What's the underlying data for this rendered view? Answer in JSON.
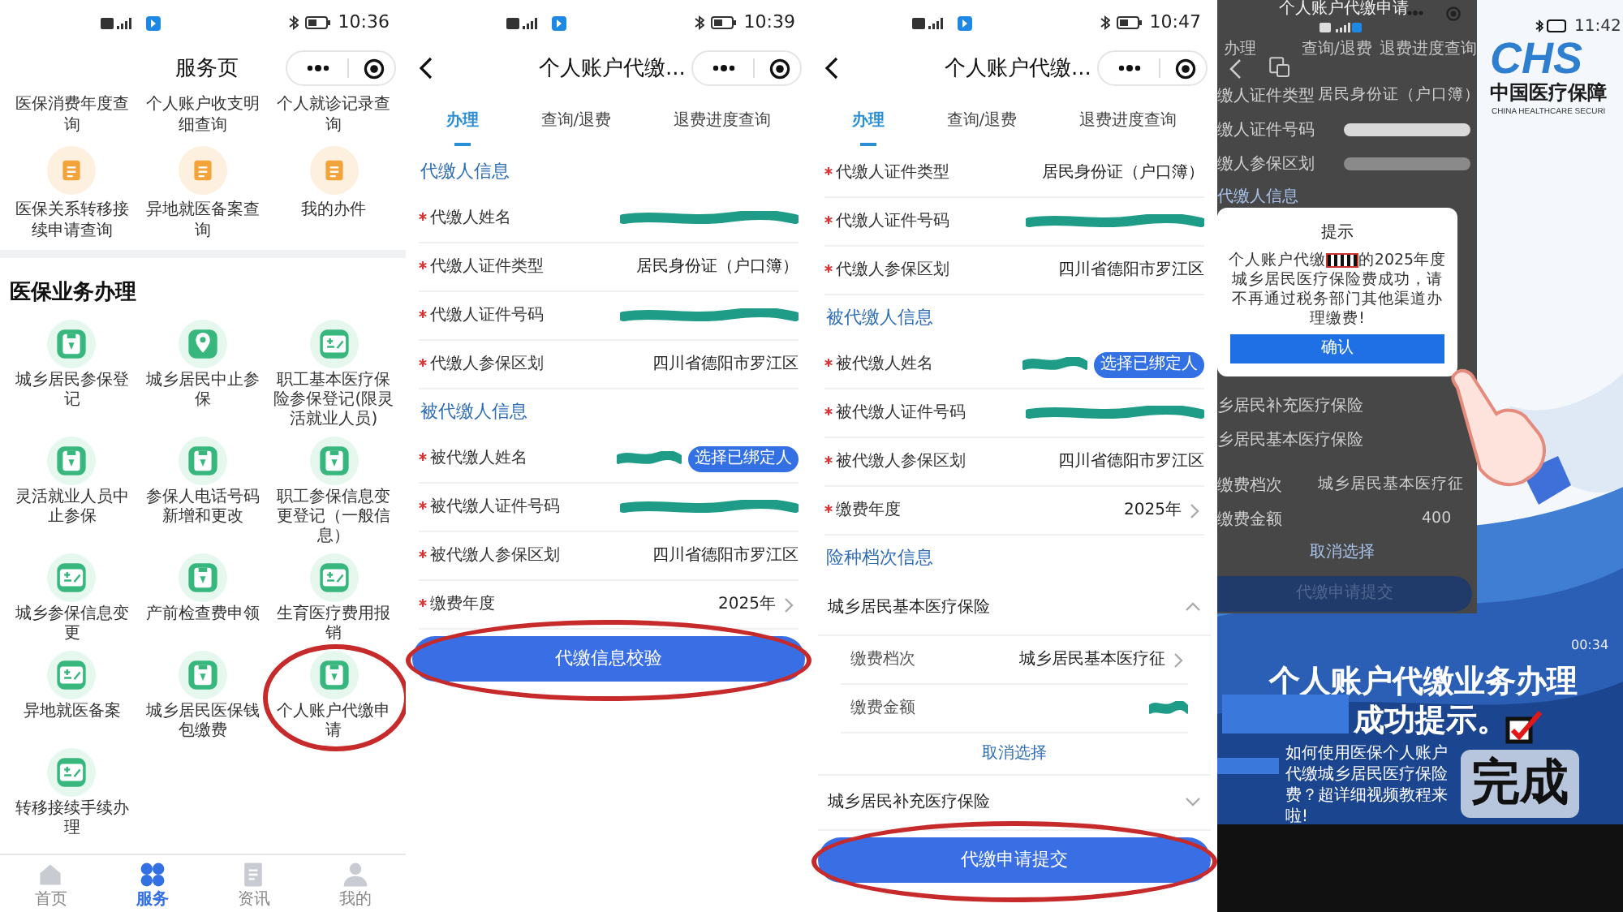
{
  "panels": [
    {
      "kind": "service",
      "time": "10:36",
      "title": "服务页",
      "upper_items": [
        {
          "label": "医保消费年度查询",
          "kind": "plain"
        },
        {
          "label": "个人账户收支明细查询",
          "kind": "plain"
        },
        {
          "label": "个人就诊记录查询",
          "kind": "plain"
        },
        {
          "label": "医保关系转移接续申请查询",
          "kind": "orange"
        },
        {
          "label": "异地就医备案查询",
          "kind": "orange"
        },
        {
          "label": "我的办件",
          "kind": "orange"
        }
      ],
      "section_title": "医保业务办理",
      "items": [
        {
          "label": "城乡居民参保登记",
          "circled": false
        },
        {
          "label": "城乡居民中止参保",
          "circled": false
        },
        {
          "label": "职工基本医疗保险参保登记(限灵活就业人员)",
          "circled": false
        },
        {
          "label": "灵活就业人员中止参保",
          "circled": false
        },
        {
          "label": "参保人电话号码新增和更改",
          "circled": false
        },
        {
          "label": "职工参保信息变更登记（一般信息）",
          "circled": false
        },
        {
          "label": "城乡参保信息变更",
          "circled": false
        },
        {
          "label": "产前检查费申领",
          "circled": false
        },
        {
          "label": "生育医疗费用报销",
          "circled": false
        },
        {
          "label": "异地就医备案",
          "circled": false
        },
        {
          "label": "城乡居民医保钱包缴费",
          "circled": false
        },
        {
          "label": "个人账户代缴申请",
          "circled": true
        },
        {
          "label": "转移接续手续办理",
          "circled": false
        }
      ],
      "tab_bar": [
        {
          "label": "首页",
          "selected": false
        },
        {
          "label": "服务",
          "selected": true
        },
        {
          "label": "资讯",
          "selected": false
        },
        {
          "label": "我的",
          "selected": false
        }
      ]
    },
    {
      "kind": "form",
      "time": "10:39",
      "title": "个人账户代缴...",
      "tabs": [
        {
          "label": "办理",
          "selected": true
        },
        {
          "label": "查询/退费",
          "selected": false
        },
        {
          "label": "退费进度查询",
          "selected": false
        }
      ],
      "sections": [
        {
          "title": "代缴人信息",
          "rows": [
            {
              "label": "代缴人姓名",
              "kind": "redacted",
              "required": true
            },
            {
              "label": "代缴人证件类型",
              "kind": "text",
              "value": "居民身份证（户口簿）",
              "required": true
            },
            {
              "label": "代缴人证件号码",
              "kind": "redacted",
              "required": true
            },
            {
              "label": "代缴人参保区划",
              "kind": "text",
              "value": "四川省德阳市罗江区",
              "required": true
            }
          ]
        },
        {
          "title": "被代缴人信息",
          "rows": [
            {
              "label": "被代缴人姓名",
              "kind": "badge",
              "value": "选择已绑定人",
              "required": true
            },
            {
              "label": "被代缴人证件号码",
              "kind": "redacted",
              "required": true
            },
            {
              "label": "被代缴人参保区划",
              "kind": "text",
              "value": "四川省德阳市罗江区",
              "required": true
            },
            {
              "label": "缴费年度",
              "kind": "select",
              "value": "2025年",
              "required": true
            }
          ]
        }
      ],
      "button": {
        "label": "代缴信息校验",
        "circled": true
      }
    },
    {
      "kind": "form",
      "time": "10:47",
      "title": "个人账户代缴...",
      "tabs": [
        {
          "label": "办理",
          "selected": true
        },
        {
          "label": "查询/退费",
          "selected": false
        },
        {
          "label": "退费进度查询",
          "selected": false
        }
      ],
      "sections": [
        {
          "rows": [
            {
              "label": "代缴人证件类型",
              "kind": "text",
              "value": "居民身份证（户口簿）",
              "required": true
            },
            {
              "label": "代缴人证件号码",
              "kind": "redacted",
              "required": true
            },
            {
              "label": "代缴人参保区划",
              "kind": "text",
              "value": "四川省德阳市罗江区",
              "required": true
            }
          ]
        },
        {
          "title": "被代缴人信息",
          "rows": [
            {
              "label": "被代缴人姓名",
              "kind": "badge",
              "value": "选择已绑定人",
              "required": true
            },
            {
              "label": "被代缴人证件号码",
              "kind": "redacted",
              "required": true
            },
            {
              "label": "被代缴人参保区划",
              "kind": "text",
              "value": "四川省德阳市罗江区",
              "required": true
            },
            {
              "label": "缴费年度",
              "kind": "select",
              "value": "2025年",
              "required": true
            }
          ]
        },
        {
          "title": "险种档次信息",
          "groups": [
            {
              "title": "城乡居民基本医疗保险",
              "expanded": true,
              "rows": [
                {
                  "label": "缴费档次",
                  "kind": "select",
                  "value": "城乡居民基本医疗征",
                  "required": false
                },
                {
                  "label": "缴费金额",
                  "kind": "redacted",
                  "required": false
                }
              ],
              "action": "取消选择"
            },
            {
              "title": "城乡居民补充医疗保险",
              "expanded": false
            }
          ]
        }
      ],
      "button": {
        "label": "代缴申请提交",
        "circled": true
      }
    },
    {
      "kind": "video",
      "time": "11:42",
      "app_title": "个人账户代缴申请",
      "tabs": [
        "办理",
        "查询/退费",
        "退费进度查询"
      ],
      "rows": [
        {
          "label": "缴人证件类型",
          "value": "居民身份证（户口簿）"
        },
        {
          "label": "缴人证件号码"
        },
        {
          "label": "缴人参保区划"
        }
      ],
      "section": "代缴人信息",
      "dialog": {
        "title": "提示",
        "message_start": "个人账户代缴",
        "message_end": "的2025年度城乡居民医疗保险费成功，请不再通过税务部门其他渠道办理缴费!",
        "confirm": "确认"
      },
      "lower_rows": [
        {
          "label": "乡居民补充医疗保险"
        },
        {
          "label": "乡居民基本医疗保险"
        },
        {
          "label": "缴费档次",
          "value": "城乡居民基本医疗征"
        },
        {
          "label": "缴费金额",
          "value": "400"
        }
      ],
      "lower_action": "取消选择",
      "lower_button": "代缴申请提交",
      "logo": {
        "mark": "CHS",
        "name": "中国医疗保障",
        "english": "CHINA HEALTHCARE SECURI"
      },
      "timer": "00:34",
      "headline": "个人账户代缴业务办理",
      "subline": "成功提示。",
      "stamp": "完成",
      "caption": "如何使用医保个人账户代缴城乡居民医疗保险费？超详细视频教程来啦!"
    }
  ]
}
